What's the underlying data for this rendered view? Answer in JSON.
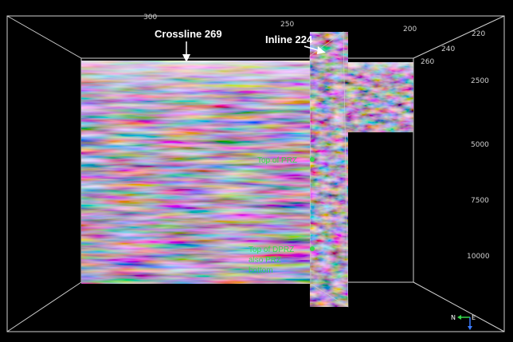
{
  "viewer": {
    "sections": {
      "crossline_label": "Crossline 269",
      "inline_label": "Inline 224"
    },
    "markers": [
      {
        "lines": [
          "Top of PRZ"
        ]
      },
      {
        "lines": [
          "Top of DPRZ",
          "also PRZ",
          "bottom"
        ]
      }
    ],
    "axes": {
      "top_ticks": [
        "300",
        "250",
        "200"
      ],
      "right_top_ticks": [
        "220",
        "240",
        "260"
      ],
      "depth_ticks": [
        "2500",
        "5000",
        "7500",
        "10000"
      ]
    },
    "orientation": {
      "north": "N",
      "east": "E"
    },
    "colors": {
      "background": "#000000",
      "frame": "#cfcfcf",
      "marker": "#34d84a",
      "trough": "#1f2a7a",
      "peak": "#9a2a2a"
    }
  }
}
